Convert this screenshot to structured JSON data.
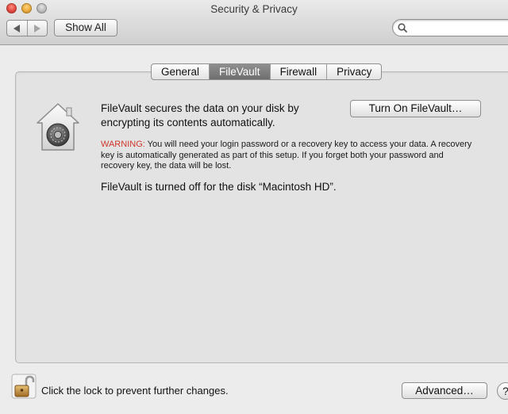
{
  "window": {
    "title": "Security & Privacy"
  },
  "toolbar": {
    "back_icon": "chevron-left-icon",
    "forward_icon": "chevron-right-icon",
    "show_all_label": "Show All",
    "search_icon": "search-icon",
    "search_value": "",
    "search_placeholder": ""
  },
  "tabs": [
    {
      "label": "General",
      "active": false
    },
    {
      "label": "FileVault",
      "active": true
    },
    {
      "label": "Firewall",
      "active": false
    },
    {
      "label": "Privacy",
      "active": false
    }
  ],
  "filevault": {
    "icon": "filevault-house-icon",
    "description": "FileVault secures the data on your disk by encrypting its contents automatically.",
    "turn_on_label": "Turn On FileVault…",
    "warning_label": "WARNING:",
    "warning_text": " You will need your login password or a recovery key to access your data. A recovery key is automatically generated as part of this setup. If you forget both your password and recovery key, the data will be lost.",
    "status": "FileVault is turned off for the disk “Macintosh HD”."
  },
  "footer": {
    "lock_icon": "unlocked-padlock-icon",
    "lock_text": "Click the lock to prevent further changes.",
    "advanced_label": "Advanced…",
    "help_label": "?"
  },
  "colors": {
    "warning": "#d0352a",
    "active_tab": "#7f7f7f",
    "window_bg": "#ececec",
    "panel_bg": "#e3e3e3"
  }
}
